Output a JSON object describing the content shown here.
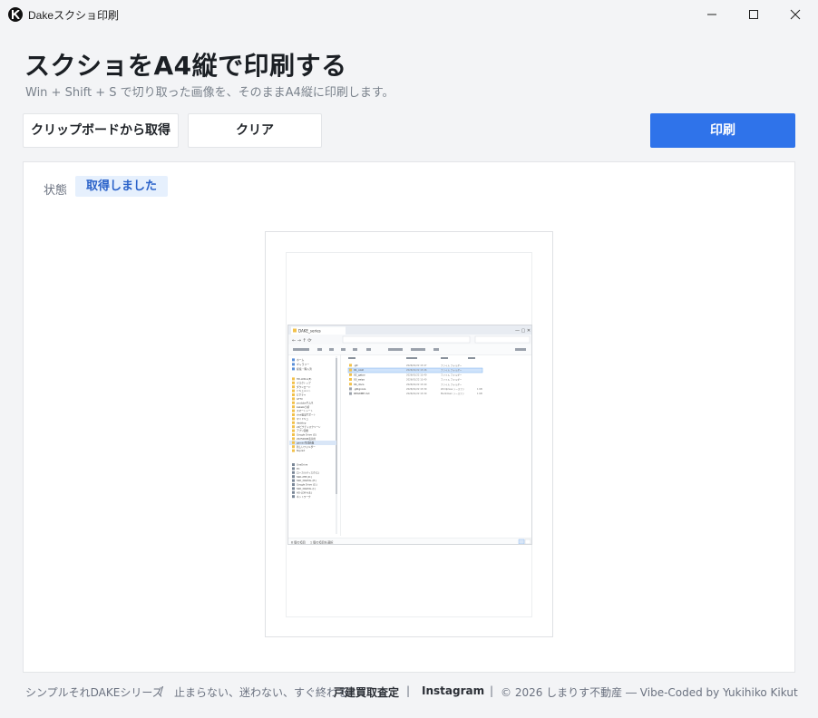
{
  "window": {
    "title": "Dakeスクショ印刷"
  },
  "header": {
    "title": "スクショをA4縦で印刷する",
    "subtitle": "Win + Shift + S で切り取った画像を、そのままA4縦に印刷します。"
  },
  "toolbar": {
    "clipboard_label": "クリップボードから取得",
    "clear_label": "クリア",
    "print_label": "印刷"
  },
  "status": {
    "label": "状態",
    "value": "取得しました"
  },
  "preview": {
    "shot_title": "DAKE_series",
    "nav": [
      "ホーム",
      "ギャラリー",
      "提案・購入済"
    ],
    "tree": [
      "HD-LDR-A(E)",
      "デスクトップ",
      "ダウンロード",
      "ドキュメント",
      "ピクチャ",
      "GTTX",
      "youtubeサムネ",
      "kakaku分析",
      "スマートシート",
      "chat電話サポート",
      "マイドキュ",
      "desktop",
      "24ピクチャスクリーン",
      "アプリ画像",
      "Google Drive (G)",
      "20250608表示用",
      "gemini生成画像",
      "新しいフォルダー",
      "8Lprint",
      "OneDrive",
      "PC",
      "ローカルディスク(C:)",
      "SSD-2TB (D:)",
      "SSD_DIGITAL (E:)",
      "Google Drive (G:)",
      "SSD_DIGITAL (I:)",
      "HD-LDR-A(E:)",
      "ネットワーク"
    ],
    "files": [
      {
        "name": ".git",
        "date": "2026/01/22 13:47",
        "kind": "ファイル フォルダー",
        "size": ""
      },
      {
        "name": "01_cost",
        "date": "2026/01/22 13:46",
        "kind": "ファイル フォルダー",
        "size": ""
      },
      {
        "name": "02_gaiyo",
        "date": "2026/01/22 13:40",
        "kind": "ファイル フォルダー",
        "size": ""
      },
      {
        "name": "03_seizo",
        "date": "2026/01/22 13:40",
        "kind": "ファイル フォルダー",
        "size": ""
      },
      {
        "name": "04_docs",
        "date": "2026/01/22 13:40",
        "kind": "ファイル フォルダー",
        "size": ""
      },
      {
        "name": ".gitignore",
        "date": "2026/01/22 13:39",
        "kind": "Wordpress ソースファ",
        "size": "1 KB"
      },
      {
        "name": "README.md",
        "date": "2026/01/22 13:39",
        "kind": "Markdown ソースファ",
        "size": "1 KB"
      }
    ],
    "status_left": "8 個の項目",
    "status_right": "1 個の項目を選択"
  },
  "footer": {
    "series": "シンプルそれDAKEシリーズ",
    "sep1": "/",
    "tagline": "止まらない、迷わない、すぐ終わる。",
    "link1": "戸建買取査定",
    "sep2": "|",
    "link2": "Instagram",
    "sep3": "|",
    "copyright": "© 2026 しまりす不動産 ― Vibe-Coded by Yukihiko Kikut"
  },
  "colors": {
    "accent": "#2f73ea",
    "badge_bg": "#e6f0fd",
    "badge_text": "#2a62c9",
    "background": "#f3f4f6"
  }
}
